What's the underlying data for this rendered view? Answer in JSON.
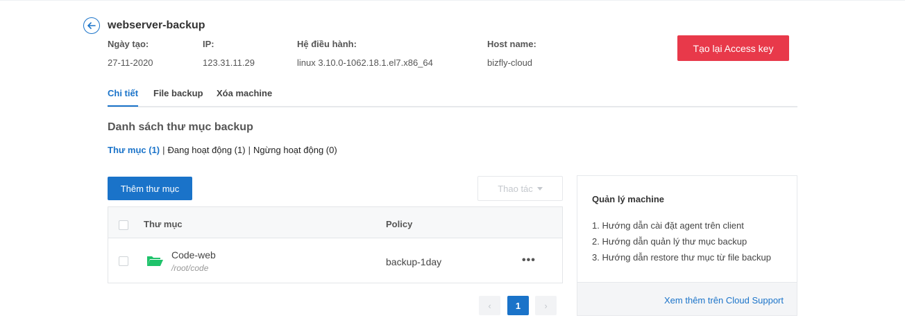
{
  "header": {
    "title": "webserver-backup",
    "back_icon": "arrow-left-circle-icon",
    "meta": [
      {
        "label": "Ngày tạo:",
        "value": "27-11-2020"
      },
      {
        "label": "IP:",
        "value": "123.31.11.29"
      },
      {
        "label": "Hệ điều hành:",
        "value": "linux 3.10.0-1062.18.1.el7.x86_64"
      },
      {
        "label": "Host name:",
        "value": "bizfly-cloud"
      }
    ],
    "regen_button": "Tạo lại Access key"
  },
  "tabs": [
    {
      "label": "Chi tiết",
      "active": true
    },
    {
      "label": "File backup",
      "active": false
    },
    {
      "label": "Xóa machine",
      "active": false
    }
  ],
  "section": {
    "title": "Danh sách thư mục backup",
    "filters": [
      {
        "label": "Thư mục (1)",
        "active": true
      },
      {
        "label": "Đang hoạt động (1)",
        "active": false
      },
      {
        "label": "Ngừng hoạt động (0)",
        "active": false
      }
    ],
    "add_button": "Thêm thư mục",
    "action_button": "Thao tác"
  },
  "table": {
    "columns": [
      "Thư mục",
      "Policy"
    ],
    "rows": [
      {
        "name": "Code-web",
        "path": "/root/code",
        "policy": "backup-1day",
        "more": "•••"
      }
    ]
  },
  "pagination": {
    "prev": "‹",
    "current": "1",
    "next": "›"
  },
  "panel": {
    "title": "Quản lý machine",
    "items": [
      "1. Hướng dẫn cài đặt agent trên client",
      "2. Hướng dẫn quản lý thư mục backup",
      "3. Hướng dẫn restore thư mục từ file backup"
    ],
    "footer_link": "Xem thêm trên Cloud Support"
  },
  "colors": {
    "primary": "#1a73c9",
    "danger": "#e8394a",
    "folder": "#1ec26a"
  }
}
